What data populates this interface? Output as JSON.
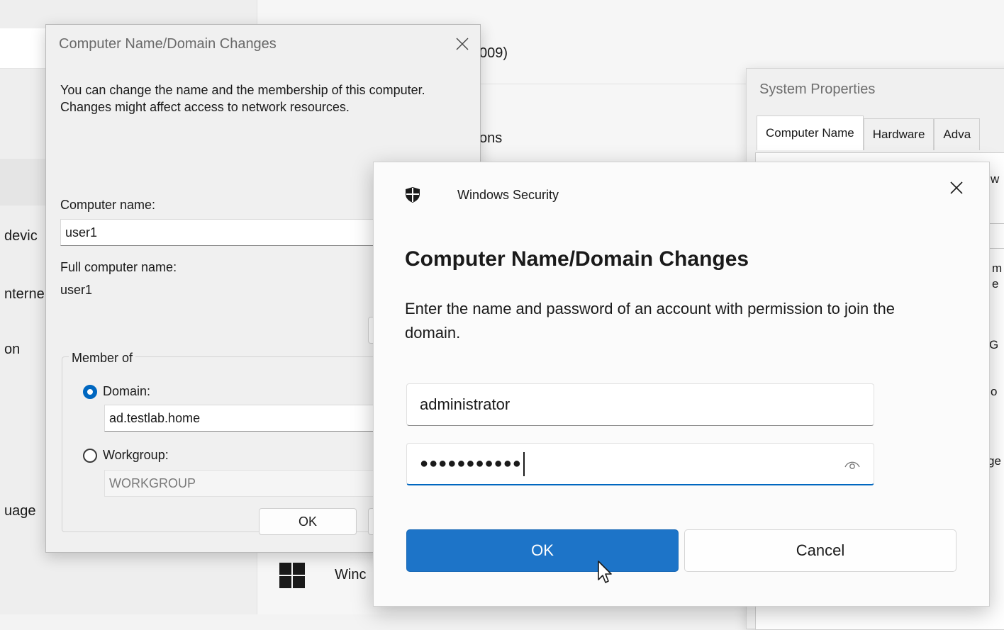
{
  "background": {
    "left_items": [
      "devic",
      "nterne",
      "on",
      "uage"
    ],
    "right_fragments": [
      "009)",
      "ons",
      "Winc"
    ]
  },
  "system_properties": {
    "title": "System Properties",
    "tabs": [
      "Computer Name",
      "Hardware",
      "Adva"
    ],
    "fragments": [
      "w",
      "m",
      "e",
      "G",
      "o",
      "ge"
    ]
  },
  "computer_name_dialog": {
    "title": "Computer Name/Domain Changes",
    "description": "You can change the name and the membership of this computer. Changes might affect access to network resources.",
    "computer_name_label": "Computer name:",
    "computer_name_value": "user1",
    "full_name_label": "Full computer name:",
    "full_name_value": "user1",
    "member_of_label": "Member of",
    "domain_label": "Domain:",
    "domain_value": "ad.testlab.home",
    "domain_selected": true,
    "workgroup_label": "Workgroup:",
    "workgroup_value": "WORKGROUP",
    "ok_label": "OK"
  },
  "windows_security": {
    "app_name": "Windows Security",
    "heading": "Computer Name/Domain Changes",
    "description": "Enter the name and password of an account with permission to join the domain.",
    "username_value": "administrator",
    "password_mask": "●●●●●●●●●●●",
    "ok_label": "OK",
    "cancel_label": "Cancel"
  },
  "colors": {
    "accent": "#0067c0",
    "primary_button": "#1d74c8"
  }
}
